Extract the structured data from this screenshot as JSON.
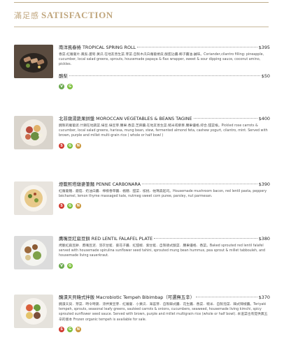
{
  "header": {
    "zh": "滿足感",
    "en": "SATISFACTION"
  },
  "colors": {
    "accent": "#c0a67d",
    "vegan": "#6aa84f",
    "gluten_free": "#7cbf3c",
    "spicy": "#d13a2f",
    "nut": "#c9963a"
  },
  "items": [
    {
      "name": "南洋風春捲 TROPICAL SPRING ROLL",
      "price": "$395",
      "desc": "香菜.紅蘿蔔片.鳳梨.蘆筍.黃瓜.在地友善生菜.芽菜.自製木瓜白蘿蔔捲皮.酸甜沾醬.椰子醬油.鹹味。Coriander,cilantro filling: pineapple, cucumber, local salad greens, sprouts, housemade papaya & flax wrapper, sweet & sour dipping sauce, coconut amino, pickles.",
      "extra_name": "酪梨",
      "extra_price": "$50",
      "badges": [
        "V",
        "G"
      ]
    },
    {
      "name": "北非燉湯蔬果拼盤 MOROCCAN VEGETABLES & BEANS TAGINE",
      "price": "$400",
      "desc": "醃製的蘿蔔泥.什錦在地蔬菜.綠豆.綠豆芽.腰果.香菜.芝麻醬.在地友善生菜.糙米或藜麥.腰果優格.綜合.甜菜根。Pickled rose carrots & cucumber, local salad greens, harissa, mung bean, stew, fermented almond feta, cashew yogurt, cilantro, mint. Served with brown, purple and millet multi-grain rice ( whole or half bowl )",
      "badges": [
        "S",
        "G",
        "N"
      ]
    },
    {
      "name": "燈籠熙塔燉麥筆麵 PENNE CARBONARA",
      "price": "$390",
      "desc": "紅蘿蔔麵．蘑菇．奶油白醬．檸檬香草醬．楓糖．甜菜．核桃．帕瑪森起司。Housemade mushroom bacon, red lentil pasta, peppery béchamel, lemon thyme massaged kale, nutmeg sweet corn puree, parsley, nut parmesan.",
      "badges": [
        "S",
        "G",
        "N"
      ]
    },
    {
      "name": "鷹嘴豆紅扁豆餅 RED LENTIL FALAFEL PLATE",
      "price": "$380",
      "desc": "烤脆紅扁豆餅．鷹嘴豆泥．羽衣甘藍．葵花子醬．紅甜椒．紫甘藍．自製德式酸菜．腰果優格．香菜。Baked sprouted red lentil falafel served with housemade spirulina sunflower seed tahini, sprouted mung bean hummus, pea sprout & millet tabbouleh, and housemade living sauerkraut.",
      "badges": [
        "V",
        "G"
      ]
    },
    {
      "name": "醃漬天貝韓式拌飯 Macrobiotic Tempeh Bibimbap（可選無五辛）",
      "price": "$370",
      "desc": "醃漬天貝．芽菜．時令時蔬．涼拌黃豆芽．紅蘿蔔．小黃瓜．海苔芽．自製韓式醬．花生醬．香菜．糙米．自製泡菜．韓式辣椒醬。Teriyaki tempeh, sprouts, seasonal leafy greens, sautéed carrots & onions, cucumbers, seaweed, housemade living kimchi, spicy sprouted sunflower seed sauce. Served with brown, purple and millet multigrain rice (whole or half bowl). 本道菜也有提供無五辛的版本 Frozen organic tempeh is available for sale.",
      "badges": [
        "S",
        "G",
        "N"
      ]
    }
  ]
}
